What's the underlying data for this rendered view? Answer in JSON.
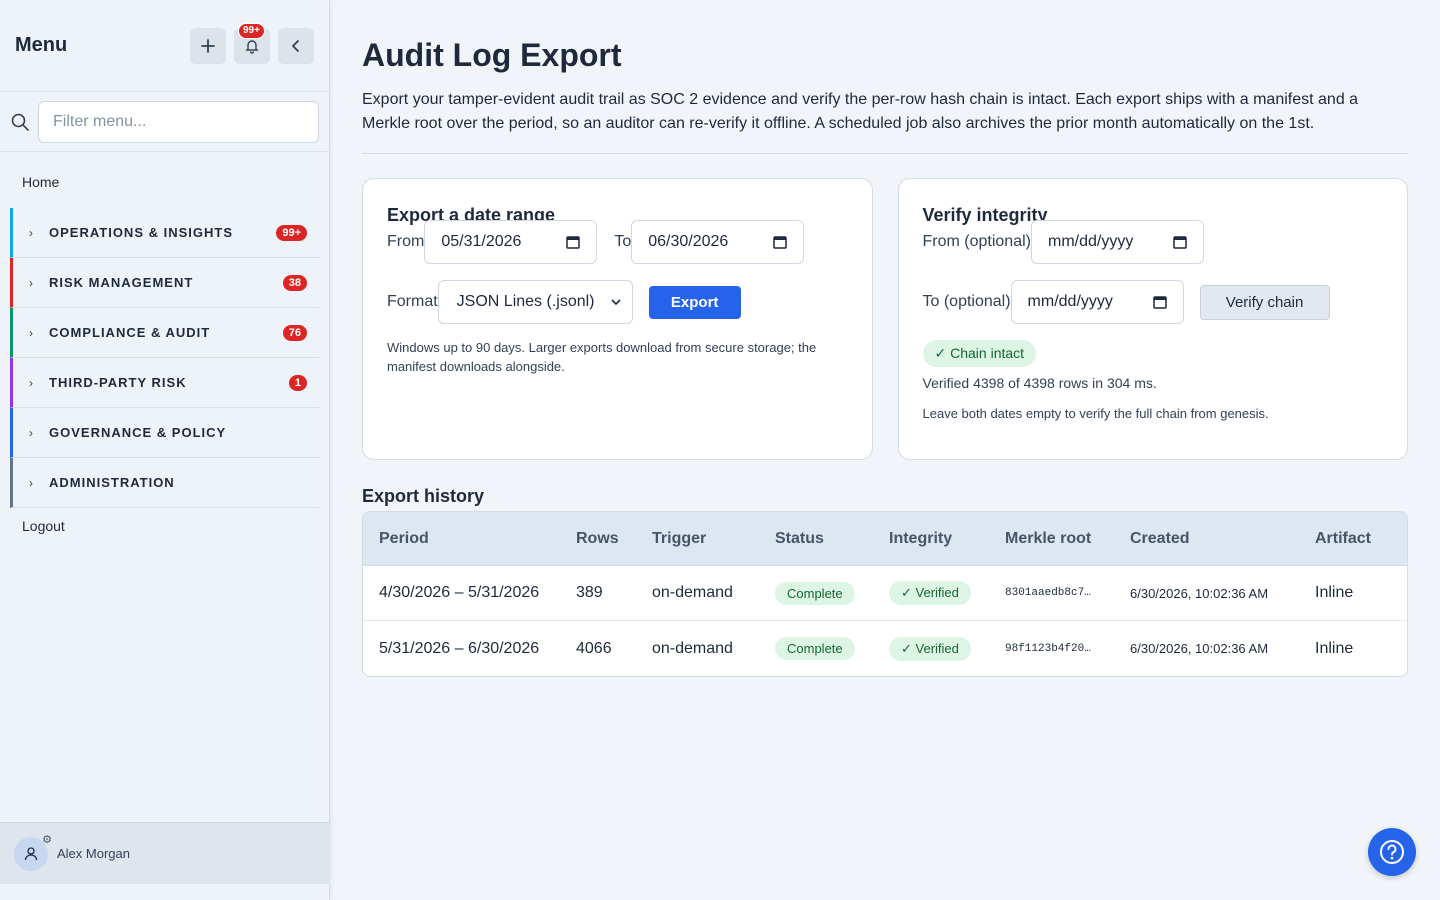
{
  "sidebar": {
    "title": "Menu",
    "add_icon": "plus-icon",
    "notifications_badge": "99+",
    "collapse_icon": "chevron-left-icon",
    "filter_placeholder": "Filter menu...",
    "home_label": "Home",
    "groups": [
      {
        "label": "OPERATIONS & INSIGHTS",
        "badge": "99+",
        "color": "#0ea5e9"
      },
      {
        "label": "RISK MANAGEMENT",
        "badge": "38",
        "color": "#dc2626"
      },
      {
        "label": "COMPLIANCE & AUDIT",
        "badge": "76",
        "color": "#059669"
      },
      {
        "label": "THIRD-PARTY RISK",
        "badge": "1",
        "color": "#9333ea"
      },
      {
        "label": "GOVERNANCE & POLICY",
        "badge": "",
        "color": "#2563eb"
      },
      {
        "label": "ADMINISTRATION",
        "badge": "",
        "color": "#64748b"
      }
    ],
    "logout_label": "Logout",
    "user_name": "Alex Morgan"
  },
  "page": {
    "title": "Audit Log Export",
    "description": "Export your tamper-evident audit trail as SOC 2 evidence and verify the per-row hash chain is intact. Each export ships with a manifest and a Merkle root over the period, so an auditor can re-verify it offline. A scheduled job also archives the prior month automatically on the 1st."
  },
  "export_card": {
    "title": "Export a date range",
    "from_label": "From",
    "from_value": "05/31/2026",
    "to_label": "To",
    "to_value": "06/30/2026",
    "format_label": "Format",
    "format_value": "JSON Lines (.jsonl)",
    "export_button": "Export",
    "hint": "Windows up to 90 days. Larger exports download from secure storage; the manifest downloads alongside."
  },
  "verify_card": {
    "title": "Verify integrity",
    "from_label": "From (optional)",
    "from_placeholder": "mm/dd/yyyy",
    "to_label": "To (optional)",
    "to_placeholder": "mm/dd/yyyy",
    "verify_button": "Verify chain",
    "status_pill": "✓ Chain intact",
    "result_text": "Verified 4398 of 4398 rows in 304 ms.",
    "hint": "Leave both dates empty to verify the full chain from genesis."
  },
  "history": {
    "title": "Export history",
    "columns": [
      "Period",
      "Rows",
      "Trigger",
      "Status",
      "Integrity",
      "Merkle root",
      "Created",
      "Artifact"
    ],
    "rows": [
      {
        "period": "4/30/2026 – 5/31/2026",
        "rows": "389",
        "trigger": "on-demand",
        "status": "Complete",
        "integrity": "✓ Verified",
        "merkle": "8301aaedb8c7…",
        "created": "6/30/2026, 10:02:36 AM",
        "artifact": "Inline"
      },
      {
        "period": "5/31/2026 – 6/30/2026",
        "rows": "4066",
        "trigger": "on-demand",
        "status": "Complete",
        "integrity": "✓ Verified",
        "merkle": "98f1123b4f20…",
        "created": "6/30/2026, 10:02:36 AM",
        "artifact": "Inline"
      }
    ]
  },
  "help_icon": "question-circle-icon",
  "colors": {
    "accent": "#2563eb",
    "success_bg": "#dcf5e4",
    "success_text": "#166534",
    "danger": "#dc2626"
  }
}
